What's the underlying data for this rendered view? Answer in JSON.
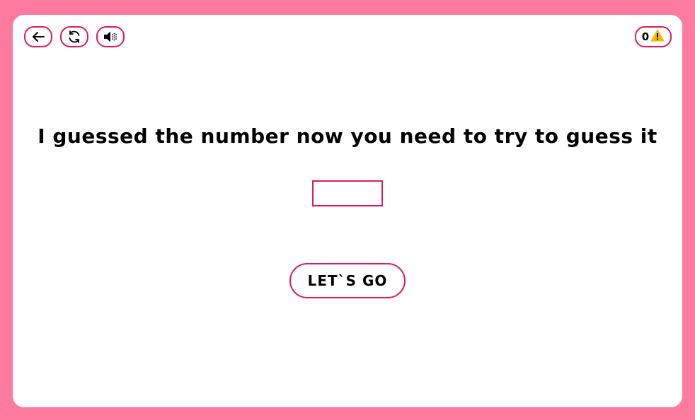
{
  "toolbar": {
    "back_icon": "arrow-left-icon",
    "restart_icon": "refresh-icon",
    "sound_icon": "speaker-icon"
  },
  "counter": {
    "value": "0",
    "icon": "warning-icon",
    "icon_color": "#f5b800"
  },
  "main": {
    "prompt": "I guessed the number now you need to try to guess it",
    "input_value": "",
    "go_label": "LET`S GO"
  },
  "colors": {
    "background": "#ff7a9f",
    "accent": "#e0195f",
    "panel": "#ffffff"
  }
}
